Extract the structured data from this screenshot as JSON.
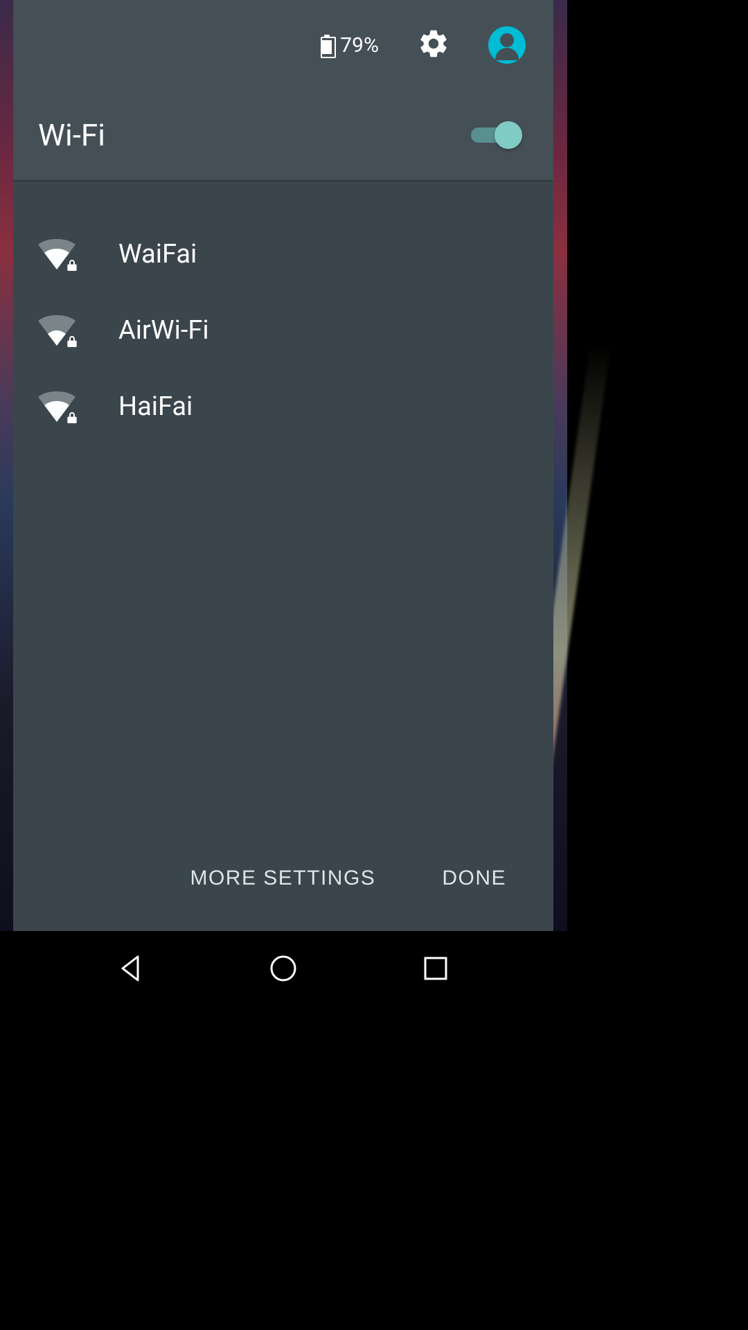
{
  "status": {
    "battery_percent": "79%"
  },
  "header": {
    "title": "Wi-Fi",
    "toggle_on": true
  },
  "networks": [
    {
      "ssid": "WaiFai",
      "signal_level": 2,
      "secured": true
    },
    {
      "ssid": "AirWi-Fi",
      "signal_level": 1,
      "secured": true
    },
    {
      "ssid": "HaiFai",
      "signal_level": 2,
      "secured": true
    }
  ],
  "footer": {
    "more_settings": "More Settings",
    "done": "Done"
  }
}
